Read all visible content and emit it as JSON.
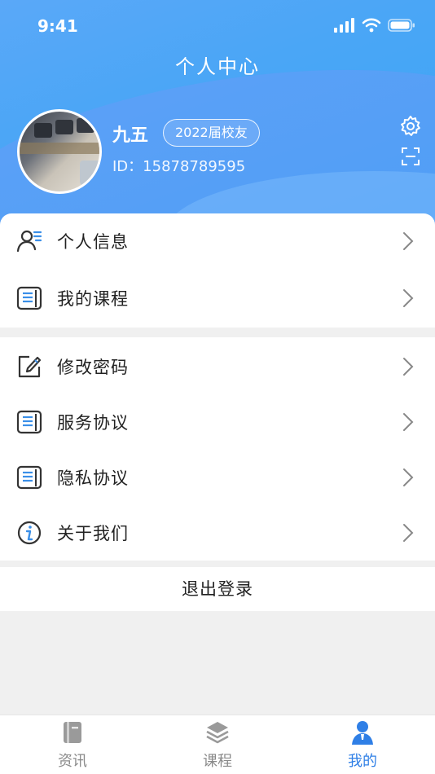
{
  "status_bar": {
    "time": "9:41"
  },
  "header": {
    "title": "个人中心",
    "user_name": "九五",
    "badge": "2022届校友",
    "user_id": "ID：15878789595"
  },
  "menu_group1": [
    {
      "label": "个人信息",
      "icon": "person-list-icon"
    },
    {
      "label": "我的课程",
      "icon": "document-icon"
    }
  ],
  "menu_group2": [
    {
      "label": "修改密码",
      "icon": "edit-icon"
    },
    {
      "label": "服务协议",
      "icon": "document-icon"
    },
    {
      "label": "隐私协议",
      "icon": "document-icon"
    },
    {
      "label": "关于我们",
      "icon": "info-icon"
    }
  ],
  "logout_label": "退出登录",
  "tabbar": [
    {
      "label": "资讯",
      "icon": "book-icon",
      "active": false
    },
    {
      "label": "课程",
      "icon": "layers-icon",
      "active": false
    },
    {
      "label": "我的",
      "icon": "user-icon",
      "active": true
    }
  ],
  "colors": {
    "accent": "#2f7fe6",
    "header": "#4aa6f6"
  }
}
